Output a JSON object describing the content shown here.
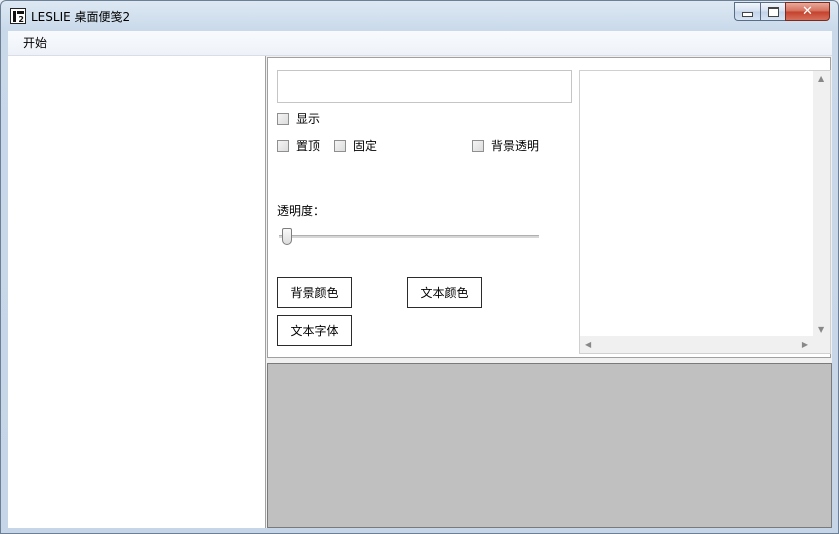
{
  "window": {
    "title": "LESLIE 桌面便笺2",
    "icon_number": "2",
    "controls": {
      "close_glyph": "✕"
    }
  },
  "menu": {
    "items": [
      {
        "label": "开始"
      }
    ]
  },
  "settings": {
    "text_input_value": "",
    "checkboxes": {
      "show": {
        "label": "显示",
        "checked": false
      },
      "topmost": {
        "label": "置顶",
        "checked": false
      },
      "fixed": {
        "label": "固定",
        "checked": false
      },
      "transparent_bg": {
        "label": "背景透明",
        "checked": false
      }
    },
    "opacity": {
      "label": "透明度：",
      "value": 0
    },
    "buttons": {
      "bg_color": "背景颜色",
      "text_color": "文本颜色",
      "text_font": "文本字体"
    }
  },
  "scroll": {
    "up": "▲",
    "down": "▼",
    "left": "◀",
    "right": "▶"
  },
  "colors": {
    "preview_background": "#c0c0c0",
    "close_button": "#c4402b"
  }
}
